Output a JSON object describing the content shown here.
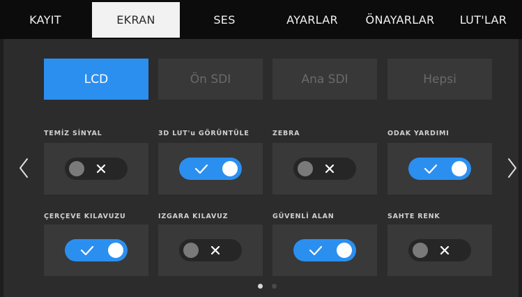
{
  "tabs": [
    {
      "label": "KAYIT",
      "active": false
    },
    {
      "label": "EKRAN",
      "active": true
    },
    {
      "label": "SES",
      "active": false
    },
    {
      "label": "AYARLAR",
      "active": false
    },
    {
      "label": "ÖNAYARLAR",
      "active": false
    },
    {
      "label": "LUT'LAR",
      "active": false
    }
  ],
  "outputs": [
    {
      "label": "LCD",
      "active": true
    },
    {
      "label": "Ön SDI",
      "active": false
    },
    {
      "label": "Ana SDI",
      "active": false
    },
    {
      "label": "Hepsi",
      "active": false
    }
  ],
  "settings": [
    {
      "label": "TEMİZ SİNYAL",
      "enabled": false
    },
    {
      "label": "3D LUT'u GÖRÜNTÜLE",
      "enabled": true
    },
    {
      "label": "ZEBRA",
      "enabled": false
    },
    {
      "label": "ODAK YARDIMI",
      "enabled": true
    },
    {
      "label": "ÇERÇEVE KILAVUZU",
      "enabled": true
    },
    {
      "label": "IZGARA KILAVUZ",
      "enabled": false
    },
    {
      "label": "GÜVENLİ ALAN",
      "enabled": true
    },
    {
      "label": "SAHTE RENK",
      "enabled": false
    }
  ],
  "pagination": {
    "current_page": 1,
    "total_pages": 2
  },
  "icons": {
    "toggle_on": "checkmark-icon",
    "toggle_off": "x-icon",
    "prev": "chevron-left-icon",
    "next": "chevron-right-icon"
  },
  "colors": {
    "accent": "#2b8ff0",
    "tab_active_bg": "#f2f2f2",
    "panel_bg": "#2c2c2c",
    "tile_bg": "#393939"
  }
}
